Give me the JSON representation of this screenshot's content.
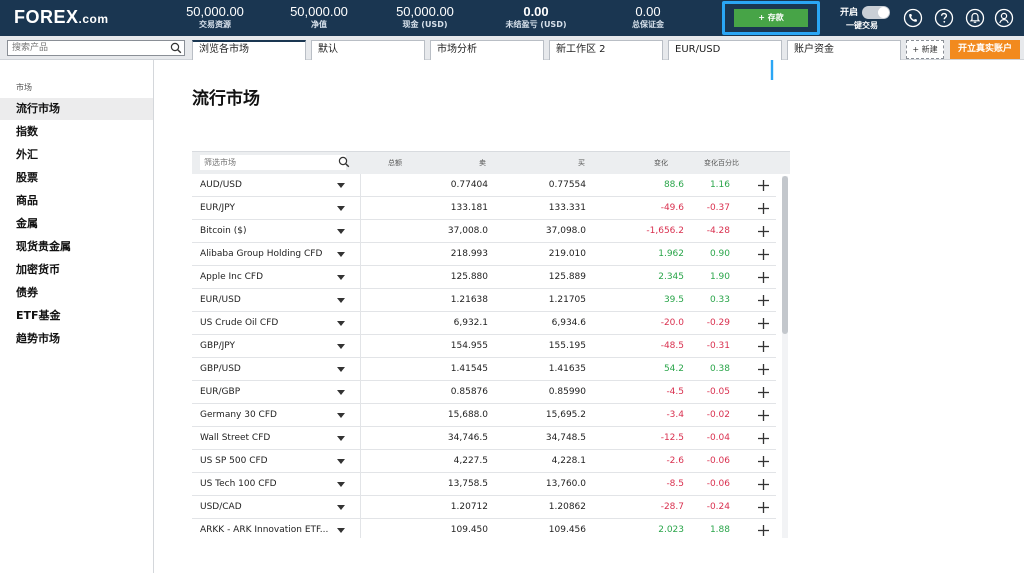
{
  "header": {
    "logo_main": "FOREX",
    "logo_suffix": ".com",
    "stats": [
      {
        "value": "50,000.00",
        "label": "交易资源",
        "bold": false
      },
      {
        "value": "50,000.00",
        "label": "净值",
        "bold": false
      },
      {
        "value": "50,000.00",
        "label": "现金 (USD)",
        "bold": false
      },
      {
        "value": "0.00",
        "label": "未结盈亏 (USD)",
        "bold": true
      },
      {
        "value": "0.00",
        "label": "总保证金",
        "bold": false
      }
    ],
    "deposit_label": "+ 存款",
    "one_click": {
      "state_label": "开启",
      "label": "一键交易"
    },
    "icons": [
      "phone-icon",
      "help-icon",
      "notification-bell-icon",
      "user-account-icon"
    ],
    "accent_color": "#2aa6f5",
    "brand_color": "#1a3651"
  },
  "tabs_bar": {
    "search_placeholder": "搜索产品",
    "tabs": [
      "浏览各市场",
      "默认",
      "市场分析",
      "新工作区 2",
      "EUR/USD",
      "账户资金"
    ],
    "new_label": "+ 新建",
    "open_account_label": "开立真实账户",
    "open_account_color": "#f28a1e"
  },
  "sidebar": {
    "heading": "市场",
    "items": [
      "流行市场",
      "指数",
      "外汇",
      "股票",
      "商品",
      "金属",
      "现货贵金属",
      "加密货币",
      "债券",
      "ETF基金",
      "趋势市场"
    ],
    "active_index": 0
  },
  "main": {
    "title": "流行市场",
    "filter_placeholder": "筛选市场",
    "columns": {
      "total": "总额",
      "sell": "卖",
      "buy": "买",
      "change": "变化",
      "change_pct": "变化百分比"
    },
    "rows": [
      {
        "name": "AUD/USD",
        "sell": "0.77404",
        "buy": "0.77554",
        "change": "88.6",
        "pct": "1.16",
        "dir": "up"
      },
      {
        "name": "EUR/JPY",
        "sell": "133.181",
        "buy": "133.331",
        "change": "-49.6",
        "pct": "-0.37",
        "dir": "down"
      },
      {
        "name": "Bitcoin ($)",
        "sell": "37,008.0",
        "buy": "37,098.0",
        "change": "-1,656.2",
        "pct": "-4.28",
        "dir": "down"
      },
      {
        "name": "Alibaba Group Holding CFD",
        "sell": "218.993",
        "buy": "219.010",
        "change": "1.962",
        "pct": "0.90",
        "dir": "up"
      },
      {
        "name": "Apple Inc CFD",
        "sell": "125.880",
        "buy": "125.889",
        "change": "2.345",
        "pct": "1.90",
        "dir": "up"
      },
      {
        "name": "EUR/USD",
        "sell": "1.21638",
        "buy": "1.21705",
        "change": "39.5",
        "pct": "0.33",
        "dir": "up"
      },
      {
        "name": "US Crude Oil CFD",
        "sell": "6,932.1",
        "buy": "6,934.6",
        "change": "-20.0",
        "pct": "-0.29",
        "dir": "down"
      },
      {
        "name": "GBP/JPY",
        "sell": "154.955",
        "buy": "155.195",
        "change": "-48.5",
        "pct": "-0.31",
        "dir": "down"
      },
      {
        "name": "GBP/USD",
        "sell": "1.41545",
        "buy": "1.41635",
        "change": "54.2",
        "pct": "0.38",
        "dir": "up"
      },
      {
        "name": "EUR/GBP",
        "sell": "0.85876",
        "buy": "0.85990",
        "change": "-4.5",
        "pct": "-0.05",
        "dir": "down"
      },
      {
        "name": "Germany 30 CFD",
        "sell": "15,688.0",
        "buy": "15,695.2",
        "change": "-3.4",
        "pct": "-0.02",
        "dir": "down"
      },
      {
        "name": "Wall Street CFD",
        "sell": "34,746.5",
        "buy": "34,748.5",
        "change": "-12.5",
        "pct": "-0.04",
        "dir": "down"
      },
      {
        "name": "US SP 500 CFD",
        "sell": "4,227.5",
        "buy": "4,228.1",
        "change": "-2.6",
        "pct": "-0.06",
        "dir": "down"
      },
      {
        "name": "US Tech 100 CFD",
        "sell": "13,758.5",
        "buy": "13,760.0",
        "change": "-8.5",
        "pct": "-0.06",
        "dir": "down"
      },
      {
        "name": "USD/CAD",
        "sell": "1.20712",
        "buy": "1.20862",
        "change": "-28.7",
        "pct": "-0.24",
        "dir": "down"
      },
      {
        "name": "ARKK - ARK Innovation ETF...",
        "sell": "109.450",
        "buy": "109.456",
        "change": "2.023",
        "pct": "1.88",
        "dir": "up"
      }
    ],
    "positive_color": "#2aa54a",
    "negative_color": "#d9304f"
  }
}
